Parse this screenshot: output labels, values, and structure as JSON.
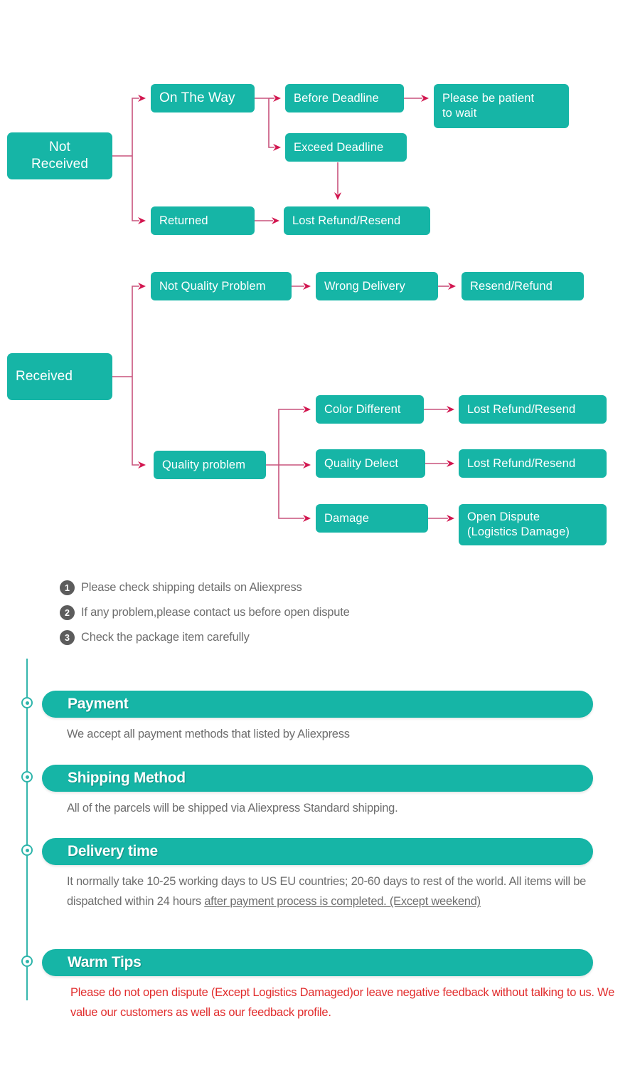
{
  "colors": {
    "teal": "#16b5a6",
    "arrow": "#d2164f",
    "line": "#d46a8c",
    "note_circle": "#5c5c5c",
    "note_text": "#6e6e6e",
    "warning_text": "#e12d2d",
    "timeline": "#2fb5ab"
  },
  "flowchart": {
    "type": "diagram",
    "branches": [
      {
        "root": "Not\nReceived",
        "children": [
          {
            "label": "On The Way",
            "children": [
              {
                "label": "Before Deadline",
                "children": [
                  {
                    "label": "Please be patient\nto wait"
                  }
                ]
              },
              {
                "label": "Exceed Deadline",
                "children": [
                  {
                    "label": "Lost Refund/Resend"
                  }
                ]
              }
            ]
          },
          {
            "label": "Returned",
            "children": [
              {
                "label": "Lost Refund/Resend"
              }
            ]
          }
        ]
      },
      {
        "root": "Received",
        "children": [
          {
            "label": "Not Quality Problem",
            "children": [
              {
                "label": "Wrong Delivery",
                "children": [
                  {
                    "label": "Resend/Refund"
                  }
                ]
              }
            ]
          },
          {
            "label": "Quality problem",
            "children": [
              {
                "label": "Color Different",
                "children": [
                  {
                    "label": "Lost Refund/Resend"
                  }
                ]
              },
              {
                "label": "Quality Delect",
                "children": [
                  {
                    "label": "Lost Refund/Resend"
                  }
                ]
              },
              {
                "label": "Damage",
                "children": [
                  {
                    "label": "Open Dispute\n(Logistics Damage)"
                  }
                ]
              }
            ]
          }
        ]
      }
    ],
    "nodes": {
      "not_received": "Not\nReceived",
      "on_the_way": "On The Way",
      "before_deadline": "Before Deadline",
      "please_be_patient": "Please be patient\nto wait",
      "exceed_deadline": "Exceed Deadline",
      "returned": "Returned",
      "lost_refund_resend_1": "Lost Refund/Resend",
      "received": "Received",
      "not_quality_problem": "Not Quality Problem",
      "wrong_delivery": "Wrong Delivery",
      "resend_refund": "Resend/Refund",
      "quality_problem": "Quality problem",
      "color_different": "Color Different",
      "lost_refund_resend_2": "Lost Refund/Resend",
      "quality_delect": "Quality Delect",
      "lost_refund_resend_3": "Lost Refund/Resend",
      "damage": "Damage",
      "open_dispute": "Open Dispute\n(Logistics Damage)"
    }
  },
  "notes": [
    {
      "num": "1",
      "text": "Please check shipping details on Aliexpress"
    },
    {
      "num": "2",
      "text": "If any problem,please contact us before open dispute"
    },
    {
      "num": "3",
      "text": "Check the package item carefully"
    }
  ],
  "sections": [
    {
      "title": "Payment",
      "body_parts": [
        {
          "text": "We accept all payment methods that listed by Aliexpress",
          "underline": false
        }
      ]
    },
    {
      "title": "Shipping Method",
      "body_parts": [
        {
          "text": "All of the parcels will be shipped via Aliexpress Standard shipping.",
          "underline": false
        }
      ]
    },
    {
      "title": "Delivery time",
      "body_parts": [
        {
          "text": "It normally take 10-25 working days to US EU countries; 20-60 days to rest of the world. All items will be dispatched within 24 hours ",
          "underline": false
        },
        {
          "text": "after payment process is completed. (Except weekend)",
          "underline": true
        }
      ]
    },
    {
      "title": "Warm Tips",
      "warning": true,
      "body_parts": [
        {
          "text": "Please do not open dispute (Except Logistics Damaged)or leave negative feedback without talking to us. We value our customers as well as our feedback profile.",
          "underline": false
        }
      ]
    }
  ]
}
